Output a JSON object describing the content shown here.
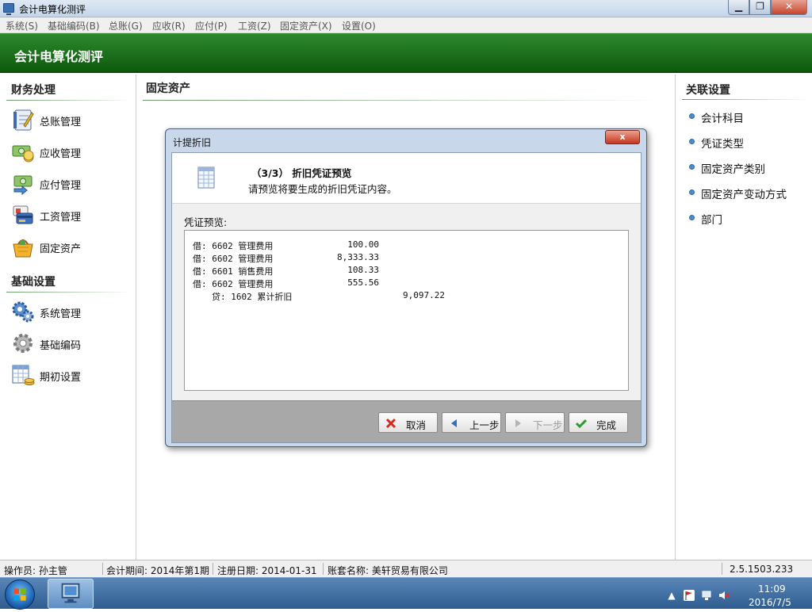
{
  "window": {
    "title": "会计电算化测评",
    "minimize": "▁",
    "maximize": "❐",
    "close": "✕"
  },
  "menu": [
    "系统(S)",
    "基础编码(B)",
    "总账(G)",
    "应收(R)",
    "应付(P)",
    "工资(Z)",
    "固定资产(X)",
    "设置(O)"
  ],
  "header": {
    "title": "会计电算化测评"
  },
  "left": {
    "section1": "财务处理",
    "items1": [
      {
        "label": "总账管理",
        "icon": "ledger-book-icon"
      },
      {
        "label": "应收管理",
        "icon": "cash-receive-icon"
      },
      {
        "label": "应付管理",
        "icon": "cash-pay-icon"
      },
      {
        "label": "工资管理",
        "icon": "salary-card-icon"
      },
      {
        "label": "固定资产",
        "icon": "shopping-basket-icon"
      }
    ],
    "section2": "基础设置",
    "items2": [
      {
        "label": "系统管理",
        "icon": "gears-icon"
      },
      {
        "label": "基础编码",
        "icon": "gear-icon"
      },
      {
        "label": "期初设置",
        "icon": "spreadsheet-coins-icon"
      }
    ]
  },
  "center": {
    "title": "固定资产"
  },
  "right": {
    "title": "关联设置",
    "links": [
      "会计科目",
      "凭证类型",
      "固定资产类别",
      "固定资产变动方式",
      "部门"
    ]
  },
  "dialog": {
    "title": "计提折旧",
    "close": "x",
    "step_title": "（3/3） 折旧凭证预览",
    "step_desc": "请预览将要生成的折旧凭证内容。",
    "preview_label": "凭证预览:",
    "rows": [
      {
        "dc": "借",
        "account": "6602 管理费用",
        "amount": "100.00"
      },
      {
        "dc": "借",
        "account": "6602 管理费用",
        "amount": "8,333.33"
      },
      {
        "dc": "借",
        "account": "6601 销售费用",
        "amount": "108.33"
      },
      {
        "dc": "借",
        "account": "6602 管理费用",
        "amount": "555.56"
      }
    ],
    "credit": {
      "dc": "贷",
      "account": "1602 累计折旧",
      "amount": "9,097.22"
    },
    "buttons": {
      "cancel": "取消",
      "prev": "上一步",
      "next": "下一步",
      "finish": "完成"
    }
  },
  "status": {
    "operator": "操作员: 孙主管",
    "period": "会计期间: 2014年第1期",
    "reg_date": "注册日期: 2014-01-31",
    "account_set": "账套名称: 美轩贸易有限公司",
    "version": "2.5.1503.233"
  },
  "taskbar": {
    "time": "11:09",
    "date": "2016/7/5"
  },
  "colors": {
    "header_green": "#1a6e1a",
    "accent_blue": "#4e8ad0"
  }
}
